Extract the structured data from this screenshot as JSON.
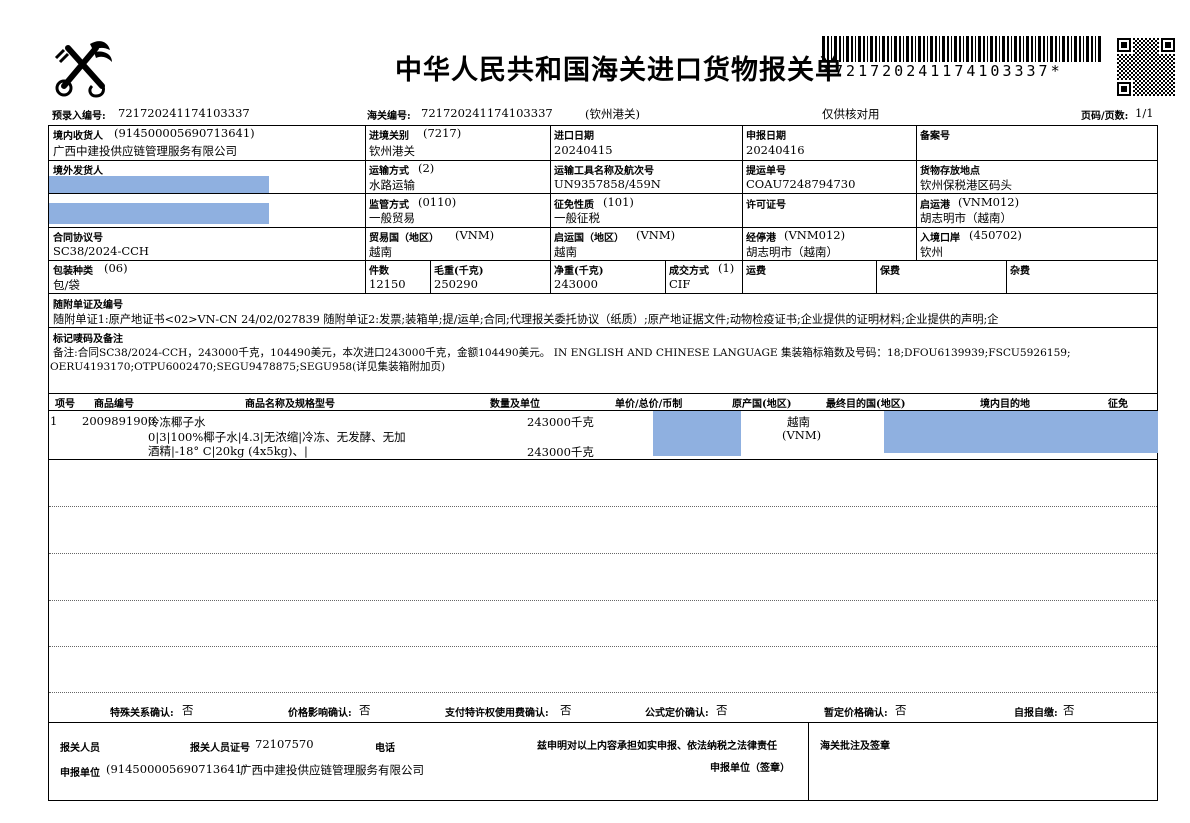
{
  "header": {
    "title": "中华人民共和国海关进口货物报关单",
    "barcode_text": "*721720241174103337*",
    "prereg_label": "预录入编号:",
    "prereg_no": "721720241174103337",
    "customs_no_label": "海关编号:",
    "customs_no": "721720241174103337",
    "port_note": "(钦州港关)",
    "check_note": "仅供核对用",
    "page_label": "页码/页数:",
    "page_value": "1/1"
  },
  "form": {
    "consignee_label": "境内收货人",
    "consignee_code": "(914500005690713641)",
    "consignee_name": "广西中建投供应链管理服务有限公司",
    "entry_customs_label": "进境关别",
    "entry_customs_code": "(7217)",
    "entry_customs_name": "钦州港关",
    "import_date_label": "进口日期",
    "import_date": "20240415",
    "declare_date_label": "申报日期",
    "declare_date": "20240416",
    "filing_no_label": "备案号",
    "overseas_shipper_label": "境外发货人",
    "transport_mode_label": "运输方式",
    "transport_mode_code": "(2)",
    "transport_mode": "水路运输",
    "vessel_label": "运输工具名称及航次号",
    "vessel": "UN9357858/459N",
    "bl_label": "提运单号",
    "bl_no": "COAU7248794730",
    "storage_label": "货物存放地点",
    "storage": "钦州保税港区码头",
    "supervision_label": "监管方式",
    "supervision_code": "(0110)",
    "supervision": "一般贸易",
    "levy_label": "征免性质",
    "levy_code": "(101)",
    "levy": "一般征税",
    "license_label": "许可证号",
    "departure_port_label": "启运港",
    "departure_port_code": "(VNM012)",
    "departure_port": "胡志明市（越南）",
    "contract_label": "合同协议号",
    "contract": "SC38/2024-CCH",
    "trade_country_label": "贸易国（地区）",
    "trade_country_code": "(VNM)",
    "trade_country": "越南",
    "origin_country_label": "启运国（地区）",
    "origin_country_code": "(VNM)",
    "origin_country": "越南",
    "transit_port_label": "经停港",
    "transit_port_code": "(VNM012)",
    "transit_port": "胡志明市（越南）",
    "entry_port_label": "入境口岸",
    "entry_port_code": "(450702)",
    "entry_port": "钦州",
    "package_label": "包装种类",
    "package_code": "(06)",
    "package": "包/袋",
    "pieces_label": "件数",
    "pieces": "12150",
    "gross_label": "毛重(千克)",
    "gross": "250290",
    "net_label": "净重(千克)",
    "net": "243000",
    "deal_label": "成交方式",
    "deal_code": "(1)",
    "deal": "CIF",
    "freight_label": "运费",
    "insurance_label": "保费",
    "misc_label": "杂费",
    "docs_label": "随附单证及编号",
    "docs": "随附单证1:原产地证书<02>VN-CN 24/02/027839 随附单证2:发票;装箱单;提/运单;合同;代理报关委托协议（纸质）;原产地证据文件;动物检疫证书;企业提供的证明材料;企业提供的声明;企",
    "marks_label": "标记唛码及备注",
    "marks_line1": "备注:合同SC38/2024-CCH，243000千克，104490美元，本次进口243000千克，金额104490美元。 IN ENGLISH AND CHINESE LANGUAGE  集装箱标箱数及号码：18;DFOU6139939;FSCU5926159;",
    "marks_line2": "OERU4193170;OTPU6002470;SEGU9478875;SEGU958(详见集装箱附加页)"
  },
  "goods_table": {
    "headers": [
      "项号",
      "商品编号",
      "商品名称及规格型号",
      "数量及单位",
      "单价/总价/币制",
      "原产国(地区)",
      "最终目的国(地区)",
      "境内目的地",
      "征免"
    ],
    "rows": [
      {
        "item_no": "1",
        "hs_code": "2009891900",
        "name": "冷冻椰子水",
        "spec_line1": "0|3|100%椰子水|4.3|无浓缩|冷冻、无发酵、无加",
        "spec_line2": "酒精|-18° C|20kg (4x5kg)、|",
        "qty1": "243000千克",
        "qty2": "243000千克",
        "origin": "越南",
        "origin_code": "(VNM)"
      }
    ]
  },
  "confirmations": [
    {
      "label": "特殊关系确认:",
      "value": "否"
    },
    {
      "label": "价格影响确认:",
      "value": "否"
    },
    {
      "label": "支付特许权使用费确认:",
      "value": "否"
    },
    {
      "label": "公式定价确认:",
      "value": "否"
    },
    {
      "label": "暂定价格确认:",
      "value": "否"
    },
    {
      "label": "自报自缴:",
      "value": "否"
    }
  ],
  "footer": {
    "declarant_label": "报关人员",
    "declarant_cert_label": "报关人员证号",
    "declarant_cert": "72107570",
    "phone_label": "电话",
    "statement": "兹申明对以上内容承担如实申报、依法纳税之法律责任",
    "unit_label": "申报单位",
    "unit_code": "(914500005690713641)",
    "unit_name": "广西中建投供应链管理服务有限公司",
    "unit_seal": "申报单位（签章）",
    "customs_remarks_label": "海关批注及签章"
  }
}
